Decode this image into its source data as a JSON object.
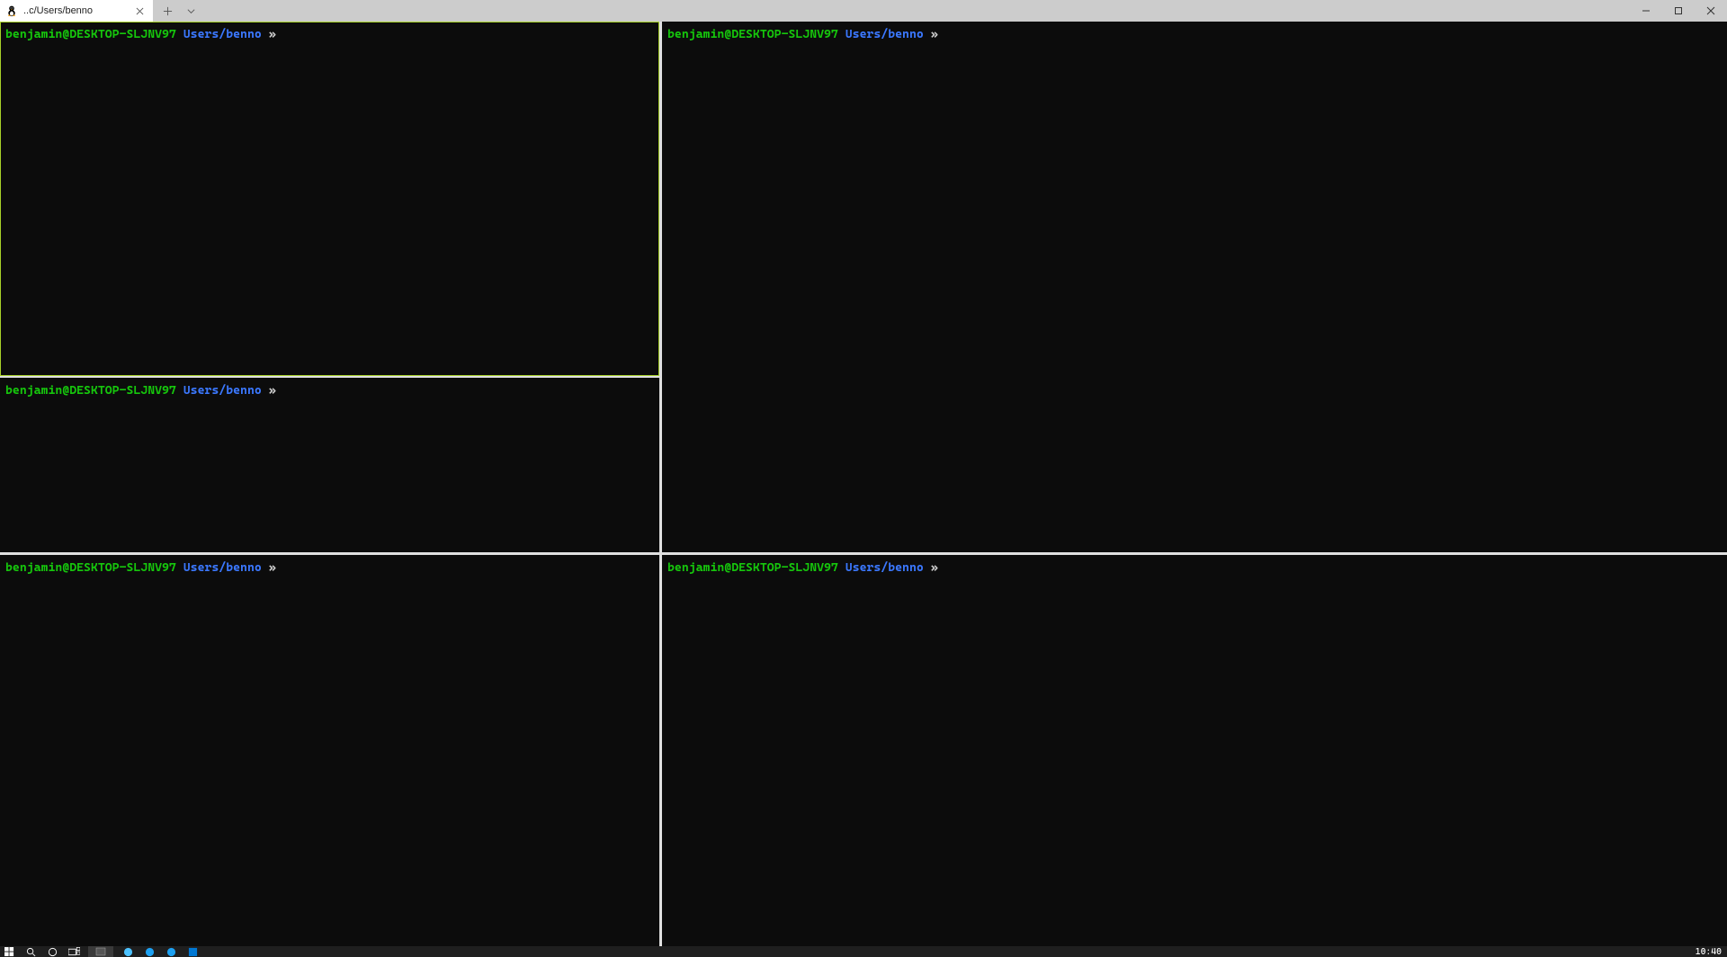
{
  "window": {
    "tab_title": "..c/Users/benno"
  },
  "prompt": {
    "user_host": "benjamin@DESKTOP-SLJNV97",
    "path": "Users/benno",
    "symbol": "»"
  },
  "colors": {
    "focus_border": "#a7d129",
    "prompt_user": "#16c60c",
    "prompt_path": "#3b78ff",
    "terminal_bg": "#0c0c0c"
  },
  "taskbar": {
    "clock": "10:40"
  }
}
